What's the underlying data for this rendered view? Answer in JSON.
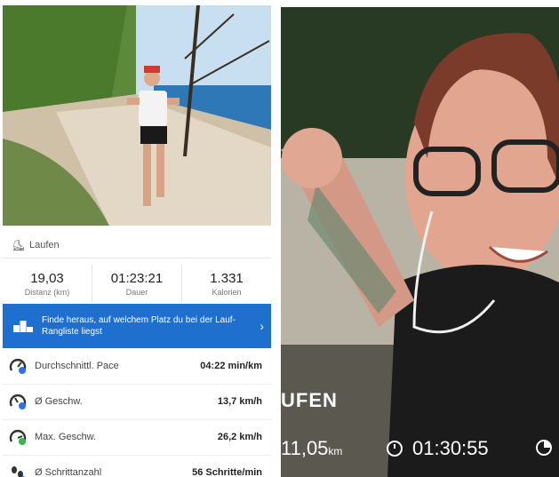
{
  "left_panel": {
    "activity": {
      "icon": "running-shoe-icon",
      "label": "Laufen"
    },
    "stats": [
      {
        "value": "19,03",
        "label": "Distanz (km)"
      },
      {
        "value": "01:23:21",
        "label": "Dauer"
      },
      {
        "value": "1.331",
        "label": "Kalorien"
      }
    ],
    "banner": {
      "text": "Finde heraus, auf welchem Platz du bei der Lauf-Rangliste liegst",
      "icon": "podium-icon",
      "chevron": "›"
    },
    "metrics": [
      {
        "label": "Durchschnittl. Pace",
        "value": "04:22 min/km",
        "icon": "pace-gauge-icon"
      },
      {
        "label": "Ø Geschw.",
        "value": "13,7 km/h",
        "icon": "speed-gauge-icon"
      },
      {
        "label": "Max. Geschw.",
        "value": "26,2 km/h",
        "icon": "max-speed-gauge-icon"
      },
      {
        "label": "Ø Schrittanzahl",
        "value": "56 Schritte/min",
        "icon": "footsteps-icon"
      }
    ]
  },
  "right_panel": {
    "title": "UFEN",
    "distance": "11,05",
    "distance_unit": "km",
    "duration": "01:30:55",
    "icons": [
      "stopwatch-icon",
      "progress-pie-icon"
    ]
  },
  "colors": {
    "banner_bg": "#1f6fcf",
    "pace_icon_blue": "#2f6ff0",
    "max_icon_green": "#3bb54a"
  }
}
